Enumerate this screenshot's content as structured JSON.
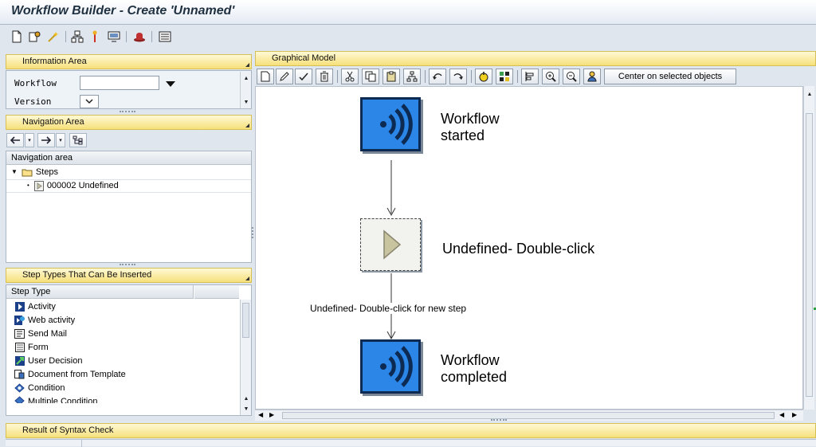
{
  "window": {
    "title": "Workflow Builder - Create 'Unnamed'"
  },
  "main_toolbar": {
    "icons": [
      "new-document-icon",
      "settings-icon",
      "magic-wand-icon",
      "hierarchy-icon",
      "pin-icon",
      "monitor-icon",
      "hat-icon",
      "list-icon"
    ]
  },
  "information_area": {
    "header": "Information Area",
    "workflow_label": "Workflow",
    "workflow_value": "",
    "version_label": "Version"
  },
  "navigation_area": {
    "header": "Navigation Area",
    "column_header": "Navigation area",
    "tree": [
      {
        "label": "Steps",
        "icon": "folder-icon"
      },
      {
        "label": "000002 Undefined",
        "icon": "step-icon"
      }
    ]
  },
  "step_types": {
    "header": "Step Types That Can Be Inserted",
    "column_header": "Step Type",
    "items": [
      {
        "label": "Activity",
        "icon": "activity-icon"
      },
      {
        "label": "Web activity",
        "icon": "web-activity-icon"
      },
      {
        "label": "Send Mail",
        "icon": "send-mail-icon"
      },
      {
        "label": "Form",
        "icon": "form-icon"
      },
      {
        "label": "User Decision",
        "icon": "user-decision-icon"
      },
      {
        "label": "Document from Template",
        "icon": "document-template-icon"
      },
      {
        "label": "Condition",
        "icon": "condition-icon"
      },
      {
        "label": "Multiple Condition",
        "icon": "multiple-condition-icon"
      }
    ]
  },
  "graphical_model": {
    "header": "Graphical Model",
    "center_button": "Center on selected objects",
    "nodes": [
      {
        "line1": "Workflow",
        "line2": "started"
      },
      {
        "line1": "Undefined- Double-click",
        "line2": ""
      },
      {
        "line1": "Workflow",
        "line2": "completed"
      }
    ],
    "edge_label": "Undefined- Double-click for new step"
  },
  "syntax_check": {
    "header": "Result of Syntax Check"
  },
  "colors": {
    "node_blue": "#2b86e8",
    "node_border": "#0d2a52",
    "header_yellow": "#f6e07a",
    "title_text": "#1f3040"
  }
}
